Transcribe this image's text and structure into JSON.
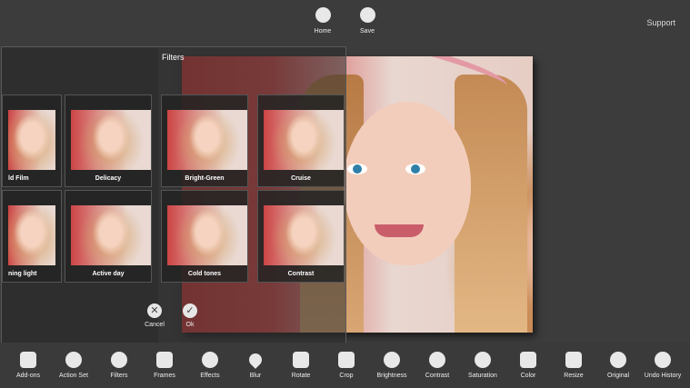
{
  "top_bar": {
    "home_label": "Home",
    "save_label": "Save",
    "support_label": "Support"
  },
  "filters_panel": {
    "title": "Filters",
    "thumbnails": [
      {
        "label": "ld Film"
      },
      {
        "label": "Delicacy"
      },
      {
        "label": "Bright-Green"
      },
      {
        "label": "Cruise"
      },
      {
        "label": "ning light"
      },
      {
        "label": "Active day"
      },
      {
        "label": "Cold tones"
      },
      {
        "label": "Contrast"
      }
    ],
    "cancel_label": "Cancel",
    "ok_label": "Ok"
  },
  "toolbar": {
    "items": [
      {
        "label": "Add-ons",
        "icon": "add-ons-icon"
      },
      {
        "label": "Action Set",
        "icon": "play-icon"
      },
      {
        "label": "Filters",
        "icon": "filters-icon"
      },
      {
        "label": "Frames",
        "icon": "frames-icon"
      },
      {
        "label": "Effects",
        "icon": "heart-icon"
      },
      {
        "label": "Blur",
        "icon": "drop-icon"
      },
      {
        "label": "Rotate",
        "icon": "rotate-icon"
      },
      {
        "label": "Crop",
        "icon": "crop-icon"
      },
      {
        "label": "Brightness",
        "icon": "sun-icon"
      },
      {
        "label": "Contrast",
        "icon": "contrast-icon"
      },
      {
        "label": "Saturation",
        "icon": "spiral-icon"
      },
      {
        "label": "Color",
        "icon": "sliders-icon"
      },
      {
        "label": "Resize",
        "icon": "resize-icon"
      },
      {
        "label": "Original",
        "icon": "eye-icon"
      },
      {
        "label": "Undo History",
        "icon": "undo-icon"
      }
    ]
  }
}
